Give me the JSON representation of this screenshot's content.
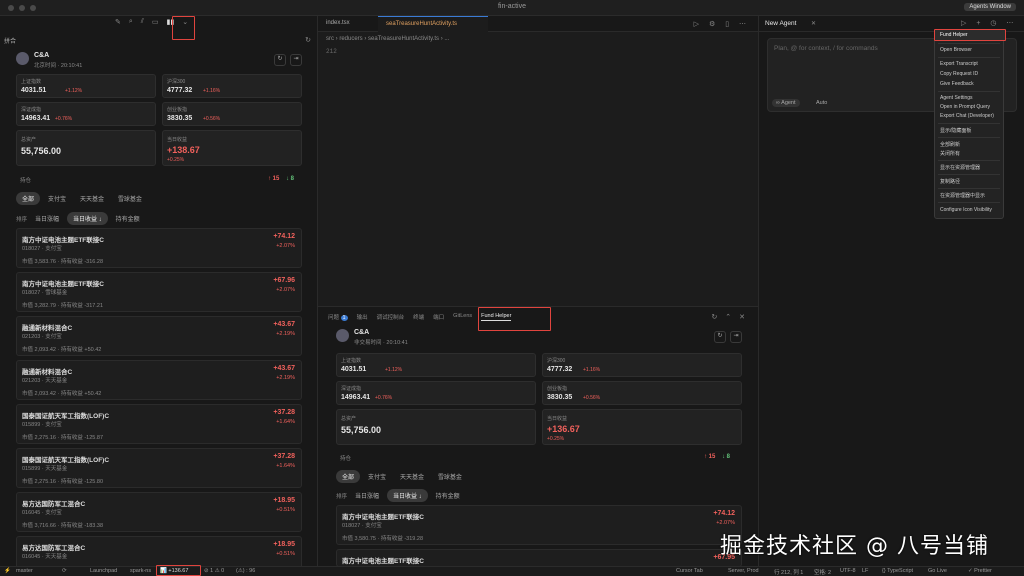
{
  "window": {
    "title": "fin-active",
    "agents_window": "Agents Window"
  },
  "sidebar": {
    "section_title": "拼合",
    "account": {
      "name": "C&A",
      "subtitle": "北京时间 · 20:10:41"
    },
    "indices": [
      {
        "name": "上证指数",
        "value": "4031.51",
        "change": "+1.12%"
      },
      {
        "name": "沪深300",
        "value": "4777.32",
        "change": "+1.16%"
      },
      {
        "name": "深证成指",
        "value": "14963.41",
        "change": "+0.76%"
      },
      {
        "name": "创业板指",
        "value": "3830.35",
        "change": "+0.56%"
      }
    ],
    "total_assets": {
      "label": "总资产",
      "value": "55,756.00"
    },
    "today_profit": {
      "label": "当日收益",
      "value": "+138.67",
      "pct": "+0.25%"
    },
    "holdings_label": "持仓",
    "up_count": "↑ 15",
    "down_count": "↓ 8",
    "filter_tabs": [
      "全部",
      "支付宝",
      "天天基金",
      "雪球基金"
    ],
    "sort_label": "排序",
    "sort_options": [
      "当日涨幅",
      "当日收益 ↓",
      "持有金额"
    ],
    "funds": [
      {
        "name": "南方中证电池主题ETF联接C",
        "code": "018027 · 支付宝",
        "foot": "市值 3,583.76 · 持有收益 -316.28",
        "v1": "+74.12",
        "v2": "+2.07%"
      },
      {
        "name": "南方中证电池主题ETF联接C",
        "code": "018027 · 雪球基金",
        "foot": "市值 3,282.79 · 持有收益 -317.21",
        "v1": "+67.96",
        "v2": "+2.07%"
      },
      {
        "name": "融通新材料混合C",
        "code": "021203 · 支付宝",
        "foot": "市值 2,093.42 · 持有收益 +50.42",
        "v1": "+43.67",
        "v2": "+2.19%"
      },
      {
        "name": "融通新材料混合C",
        "code": "021203 · 天天基金",
        "foot": "市值 2,093.42 · 持有收益 +50.42",
        "v1": "+43.67",
        "v2": "+2.19%"
      },
      {
        "name": "国泰国证航天军工指数(LOF)C",
        "code": "015899 · 支付宝",
        "foot": "市值 2,275.16 · 持有收益 -125.87",
        "v1": "+37.28",
        "v2": "+1.64%"
      },
      {
        "name": "国泰国证航天军工指数(LOF)C",
        "code": "015899 · 天天基金",
        "foot": "市值 2,275.16 · 持有收益 -125.80",
        "v1": "+37.28",
        "v2": "+1.64%"
      },
      {
        "name": "易方达国防军工混合C",
        "code": "016045 · 支付宝",
        "foot": "市值 3,716.66 · 持有收益 -183.38",
        "v1": "+18.95",
        "v2": "+0.51%"
      },
      {
        "name": "易方达国防军工混合C",
        "code": "016045 · 天天基金",
        "foot": "",
        "v1": "+18.95",
        "v2": "+0.51%"
      }
    ]
  },
  "editor": {
    "tabs": [
      "index.tsx",
      "seaTreasureHuntActivity.ts"
    ],
    "breadcrumb": "src › reducers › seaTreasureHuntActivity.ts › ...",
    "line_number": "212",
    "panel_tabs": [
      "问题",
      "输出",
      "调试控制台",
      "终端",
      "端口",
      "GitLens"
    ],
    "panel_tab_badge": "1",
    "fund_helper_tab": "Fund Helper",
    "panel": {
      "account": {
        "name": "C&A",
        "subtitle": "非交易时间 · 20:10:41"
      },
      "indices": [
        {
          "name": "上证指数",
          "value": "4031.51",
          "change": "+1.12%"
        },
        {
          "name": "沪深300",
          "value": "4777.32",
          "change": "+1.16%"
        },
        {
          "name": "深证成指",
          "value": "14963.41",
          "change": "+0.76%"
        },
        {
          "name": "创业板指",
          "value": "3830.35",
          "change": "+0.56%"
        }
      ],
      "total_assets": {
        "label": "总资产",
        "value": "55,756.00"
      },
      "today_profit": {
        "label": "当日收益",
        "value": "+136.67",
        "pct": "+0.25%"
      },
      "holdings_label": "持仓",
      "up_count": "↑ 15",
      "down_count": "↓ 8",
      "filter_tabs": [
        "全部",
        "支付宝",
        "天天基金",
        "雪球基金"
      ],
      "sort_label": "排序",
      "sort_options": [
        "当日涨幅",
        "当日收益 ↓",
        "持有金额"
      ],
      "funds": [
        {
          "name": "南方中证电池主题ETF联接C",
          "code": "018027 · 支付宝",
          "foot": "市值 3,580.75 · 持有收益 -319.28",
          "v1": "+74.12",
          "v2": "+2.07%"
        },
        {
          "name": "南方中证电池主题ETF联接C",
          "code": "",
          "foot": "",
          "v1": "+67.95",
          "v2": ""
        }
      ]
    }
  },
  "agent": {
    "tab_title": "New Agent",
    "placeholder": "Plan, @ for context, / for commands",
    "agent_pill": "∞ Agent",
    "model": "Auto"
  },
  "menu": {
    "items_group1": [
      "Fund Helper"
    ],
    "items_group2": [
      "Open Browser"
    ],
    "items_group3": [
      "Export Transcript",
      "Copy Request ID",
      "Give Feedback"
    ],
    "items_group4": [
      "Agent Settings",
      "Open in Prompt Query",
      "Export Chat (Developer)"
    ],
    "items_group5": [
      "显示/隐藏面板"
    ],
    "items_group6": [
      "全部刷新",
      "关闭所有"
    ],
    "items_group7": [
      "显示在资源管理器"
    ],
    "items_group8": [
      "复制路径"
    ],
    "items_group9": [
      "在资源管理器中显示"
    ],
    "items_group10": [
      "Configure Icon Visibility"
    ]
  },
  "statusbar": {
    "branch": "master",
    "launchpad": "Launchpad",
    "spark": "spark-ns",
    "fund_total": "📊 +136.67",
    "problems": "⊘ 1 ⚠ 0",
    "cursor_info": "(⚠) : 96",
    "cursor_tab": "Cursor Tab",
    "server": "Server, Prod",
    "position": "行 212, 列 1",
    "spaces": "空格: 2",
    "encoding": "UTF-8",
    "eol": "LF",
    "lang": "{} TypeScript",
    "golive": "Go Live",
    "prettier": "✓ Prettier"
  },
  "watermark": "掘金技术社区 @ 八号当铺"
}
